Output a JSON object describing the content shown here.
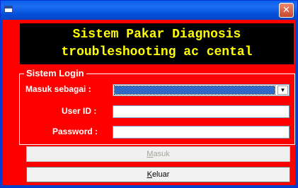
{
  "window": {
    "close_glyph": "✕"
  },
  "header": {
    "title": "Sistem Pakar Diagnosis\ntroubleshooting ac cental"
  },
  "login": {
    "group_label": "Sistem Login",
    "role_label": "Masuk sebagai :",
    "role_value": "",
    "userid_label": "User ID :",
    "userid_value": "",
    "password_label": "Password :",
    "password_value": ""
  },
  "buttons": {
    "masuk": {
      "mnemonic": "M",
      "rest": "asuk",
      "enabled": false
    },
    "keluar": {
      "mnemonic": "K",
      "rest": "eluar",
      "enabled": true
    }
  },
  "colors": {
    "form_background": "#ff0000",
    "header_background": "#000000",
    "header_text": "#ffff00",
    "titlebar": "#0a5fe8"
  },
  "icons": {
    "window_icon": "window-icon",
    "close": "close-icon",
    "dropdown": "chevron-down-icon"
  }
}
